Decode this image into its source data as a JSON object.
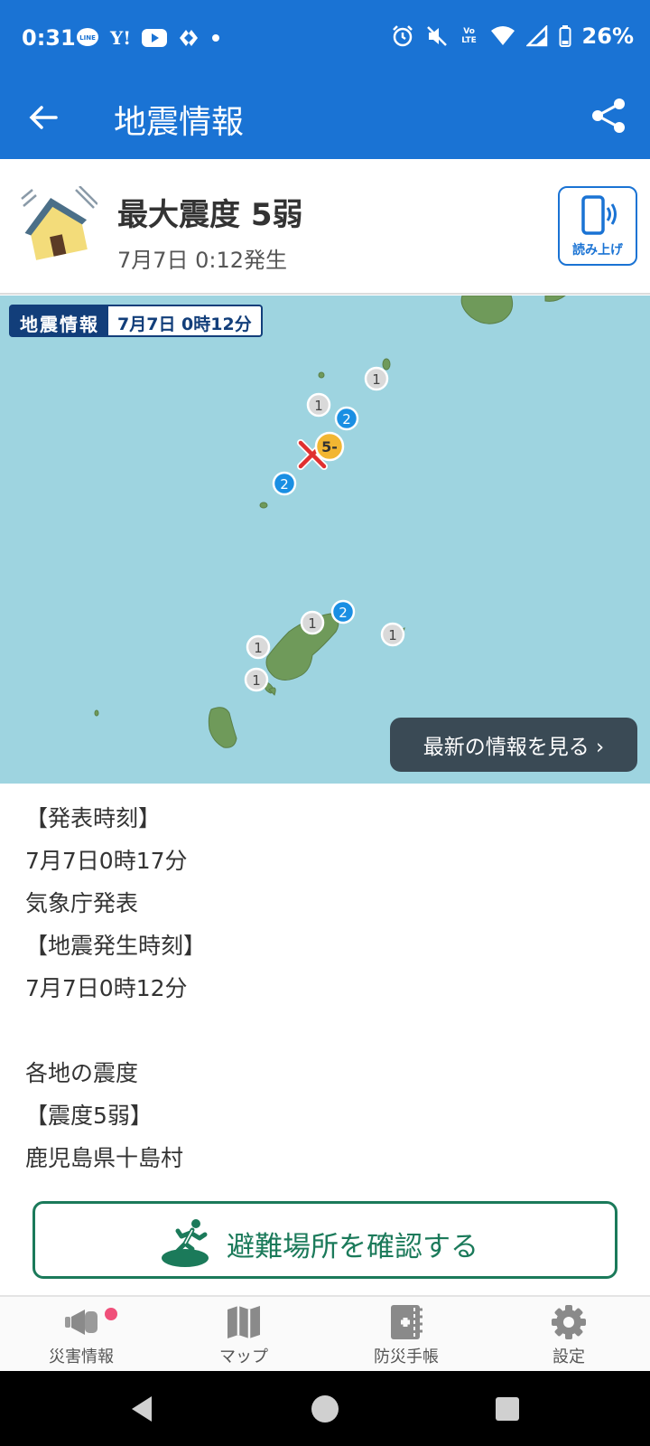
{
  "status_bar": {
    "time": "0:31",
    "app_icons": [
      "line-icon",
      "yahoo-icon",
      "youtube-icon",
      "sync-icon",
      "dot"
    ],
    "yahoo_text": "Y!",
    "line_text": "LINE",
    "volte_text": "Vo LTE",
    "battery": "26%"
  },
  "app_bar": {
    "title": "地震情報"
  },
  "summary": {
    "title": "最大震度 5弱",
    "subtitle": "7月7日 0:12発生",
    "read_aloud_label": "読み上げ"
  },
  "map": {
    "chip_label": "地震情報",
    "chip_time": "7月7日 0時12分",
    "markers": [
      "1",
      "1",
      "2",
      "5-",
      "2",
      "2",
      "1",
      "1",
      "1",
      "1"
    ],
    "latest_button": "最新の情報を見る ›"
  },
  "info": {
    "lines": [
      "【発表時刻】",
      "7月7日0時17分",
      "気象庁発表",
      "【地震発生時刻】",
      "7月7日0時12分",
      "",
      "各地の震度",
      "【震度5弱】",
      "鹿児島県十島村"
    ]
  },
  "shelter_button": {
    "label": "避難場所を確認する"
  },
  "bottom_nav": {
    "items": [
      {
        "label": "災害情報",
        "icon": "megaphone-icon"
      },
      {
        "label": "マップ",
        "icon": "map-icon"
      },
      {
        "label": "防災手帳",
        "icon": "notebook-icon"
      },
      {
        "label": "設定",
        "icon": "gear-icon"
      }
    ]
  },
  "colors": {
    "primary": "#1a73d4",
    "sea": "#9ed4e0",
    "land": "#6f9a5a",
    "shelter_green": "#1b7a5a",
    "intensity_1": "#d7d7d7",
    "intensity_2": "#1a8fe3",
    "intensity_5minus": "#f2b632",
    "epicenter": "#e03030"
  }
}
